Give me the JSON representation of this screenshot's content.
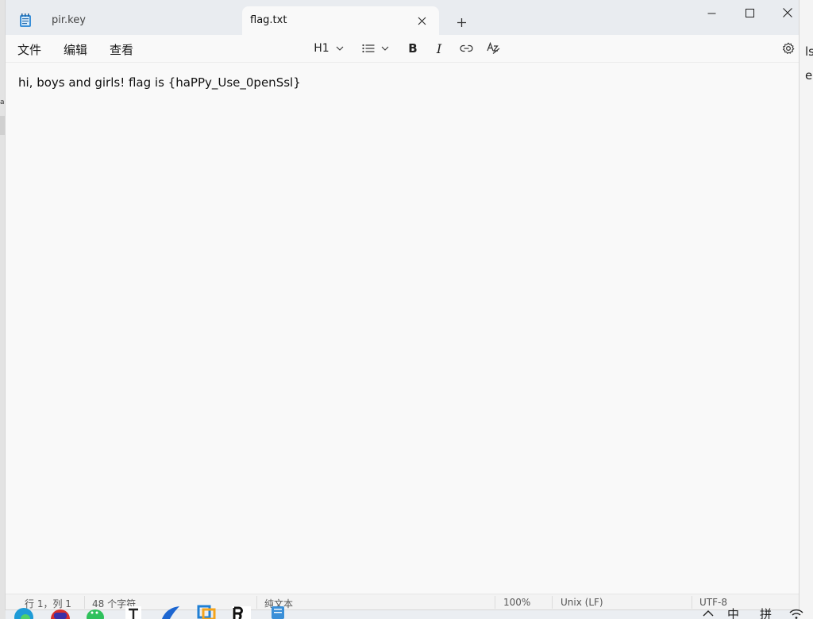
{
  "window": {
    "tabs": [
      {
        "label": "pir.key",
        "active": false
      },
      {
        "label": "flag.txt",
        "active": true
      }
    ]
  },
  "menu": {
    "file": "文件",
    "edit": "编辑",
    "view": "查看"
  },
  "toolbar": {
    "heading": "H1"
  },
  "editor": {
    "content": "hi, boys and girls! flag is {haPPy_Use_0penSsl}"
  },
  "status": {
    "position": "行 1，列 1",
    "char_count": "48 个字符",
    "format": "纯文本",
    "zoom": "100%",
    "line_ending": "Unix (LF)",
    "encoding": "UTF-8"
  },
  "tray": {
    "ime_lang": "中",
    "ime_mode": "拼"
  },
  "colors": {
    "accent": "#1a73c8",
    "titlebar": "#e9ecf0",
    "editor_bg": "#f9f9f9"
  }
}
